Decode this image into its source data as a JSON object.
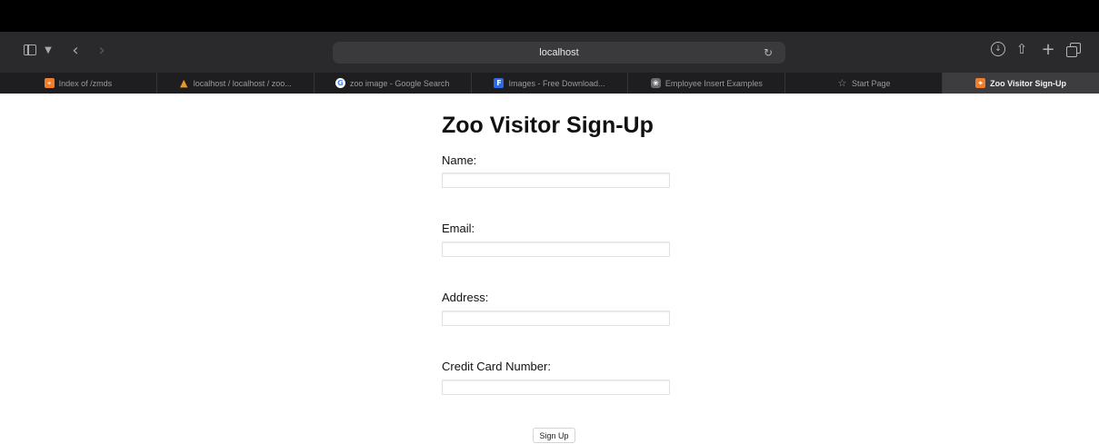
{
  "browser": {
    "address": "localhost",
    "tabs": [
      {
        "label": "Index of /zmds",
        "icon": "xampp-icon",
        "glyph": "⌖",
        "active": false
      },
      {
        "label": "localhost / localhost / zoo...",
        "icon": "phpmyadmin-icon",
        "glyph": "▲",
        "active": false
      },
      {
        "label": "zoo image - Google Search",
        "icon": "google-icon",
        "glyph": "G",
        "active": false
      },
      {
        "label": "Images - Free Download...",
        "icon": "freepik-icon",
        "glyph": "F",
        "active": false
      },
      {
        "label": "Employee Insert Examples",
        "icon": "openai-icon",
        "glyph": "❀",
        "active": false
      },
      {
        "label": "Start Page",
        "icon": "star-icon",
        "glyph": "☆",
        "active": false
      },
      {
        "label": "Zoo Visitor Sign-Up",
        "icon": "xampp-icon",
        "glyph": "⌖",
        "active": true
      }
    ]
  },
  "form": {
    "title": "Zoo Visitor Sign-Up",
    "fields": [
      {
        "label": "Name:",
        "value": "",
        "placeholder": ""
      },
      {
        "label": "Email:",
        "value": "",
        "placeholder": ""
      },
      {
        "label": "Address:",
        "value": "",
        "placeholder": ""
      },
      {
        "label": "Credit Card Number:",
        "value": "",
        "placeholder": ""
      }
    ],
    "submit_label": "Sign Up"
  },
  "colors": {
    "toolbar": "#2a2a2c",
    "tabbar": "#1e1e20",
    "active_tab": "#3d3d40",
    "xampp_orange": "#f07d2a"
  }
}
